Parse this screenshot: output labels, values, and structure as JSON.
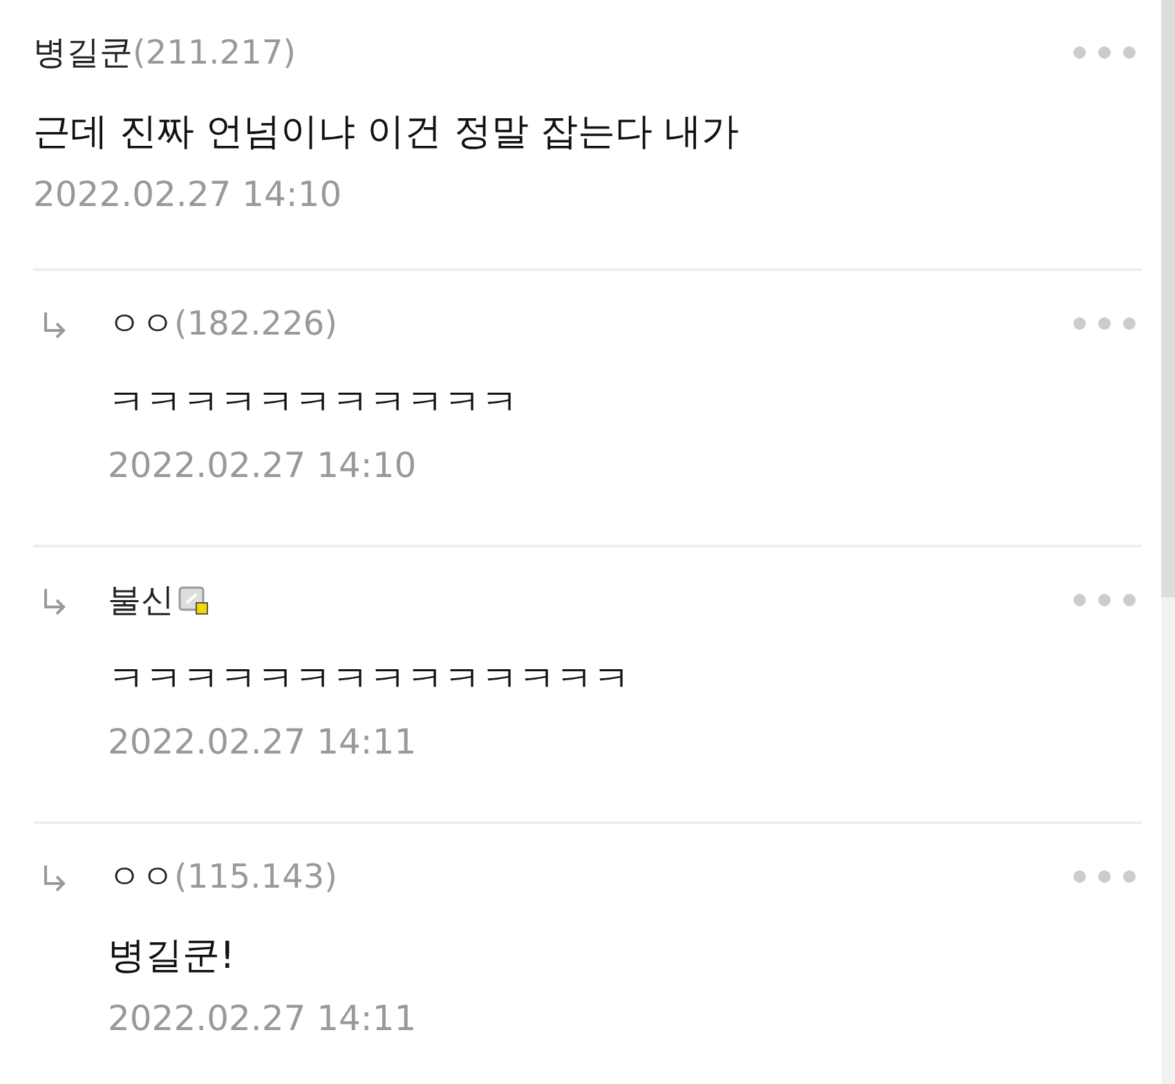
{
  "comments": [
    {
      "author": "병길쿤",
      "ip": "(211.217)",
      "member_icon": false,
      "text": "근데 진짜 언넘이냐 이건 정말 잡는다 내가",
      "time": "2022.02.27 14:10",
      "children": [
        {
          "author": "ㅇㅇ",
          "ip": "(182.226)",
          "member_icon": false,
          "text": "ㅋㅋㅋㅋㅋㅋㅋㅋㅋㅋㅋ",
          "time": "2022.02.27 14:10"
        },
        {
          "author": "불신",
          "member_icon": true,
          "text": "ㅋㅋㅋㅋㅋㅋㅋㅋㅋㅋㅋㅋㅋㅋ",
          "time": "2022.02.27 14:11"
        },
        {
          "author": "ㅇㅇ",
          "ip": "(115.143)",
          "member_icon": false,
          "text": "병길쿤!",
          "time": "2022.02.27 14:11"
        }
      ]
    }
  ]
}
